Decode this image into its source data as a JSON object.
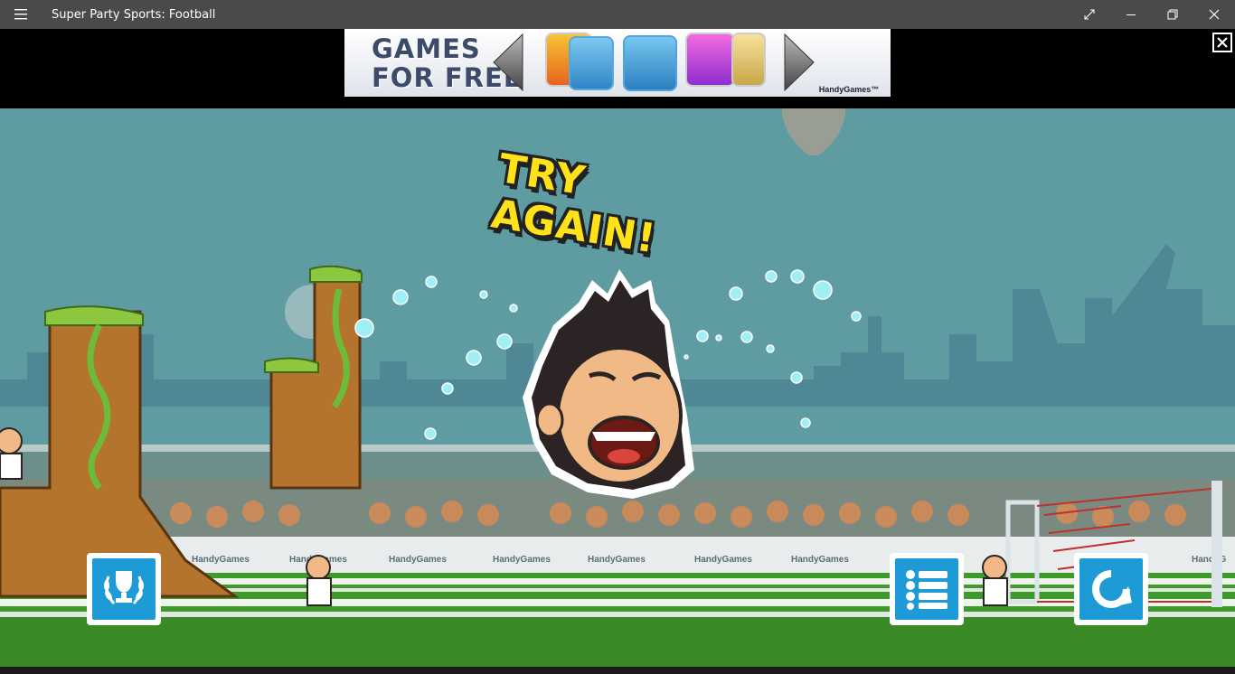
{
  "window": {
    "title": "Super Party Sports: Football",
    "menu_icon": "hamburger-menu-icon",
    "controls": [
      "fullscreen-icon",
      "minimize-icon",
      "restore-icon",
      "close-icon"
    ]
  },
  "ad": {
    "headline_line1": "GAMES",
    "headline_line2": "FOR FREE",
    "brand": "HandyGames™",
    "close_icon": "close-x-icon"
  },
  "game": {
    "message": "TRY AGAIN!",
    "buttons": {
      "achievements_icon": "trophy-laurel-icon",
      "menu_icon": "list-menu-icon",
      "retry_icon": "retry-arrow-icon"
    },
    "banner_text": "HandyGames"
  },
  "colors": {
    "sky": "#5f9ca1",
    "button_blue": "#1e9bd6",
    "title_yellow": "#ffe21a",
    "grass": "#3f9a2c"
  }
}
